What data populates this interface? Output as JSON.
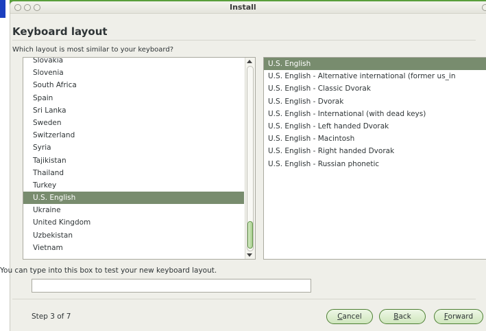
{
  "window": {
    "title": "Install"
  },
  "page": {
    "heading": "Keyboard layout",
    "question": "Which layout is most similar to your keyboard?",
    "test_label": "You can type into this box to test your new keyboard layout.",
    "test_value": "",
    "step": "Step 3 of 7"
  },
  "countries": [
    "Slovakia",
    "Slovenia",
    "South Africa",
    "Spain",
    "Sri Lanka",
    "Sweden",
    "Switzerland",
    "Syria",
    "Tajikistan",
    "Thailand",
    "Turkey",
    "U.S. English",
    "Ukraine",
    "United Kingdom",
    "Uzbekistan",
    "Vietnam"
  ],
  "selected_country": "U.S. English",
  "variants": [
    "U.S. English",
    "U.S. English - Alternative international (former us_in",
    "U.S. English - Classic Dvorak",
    "U.S. English - Dvorak",
    "U.S. English - International (with dead keys)",
    "U.S. English - Left handed Dvorak",
    "U.S. English - Macintosh",
    "U.S. English - Right handed Dvorak",
    "U.S. English - Russian phonetic"
  ],
  "selected_variant": "U.S. English",
  "scrollbar": {
    "thumb_start": 0.84,
    "thumb_size": 0.15
  },
  "buttons": {
    "cancel_mn": "C",
    "cancel_rest": "ancel",
    "back_mn": "B",
    "back_rest": "ack",
    "forward_mn": "F",
    "forward_rest": "orward"
  },
  "colors": {
    "selection": "#788c6e",
    "frame": "#4f9a32"
  }
}
